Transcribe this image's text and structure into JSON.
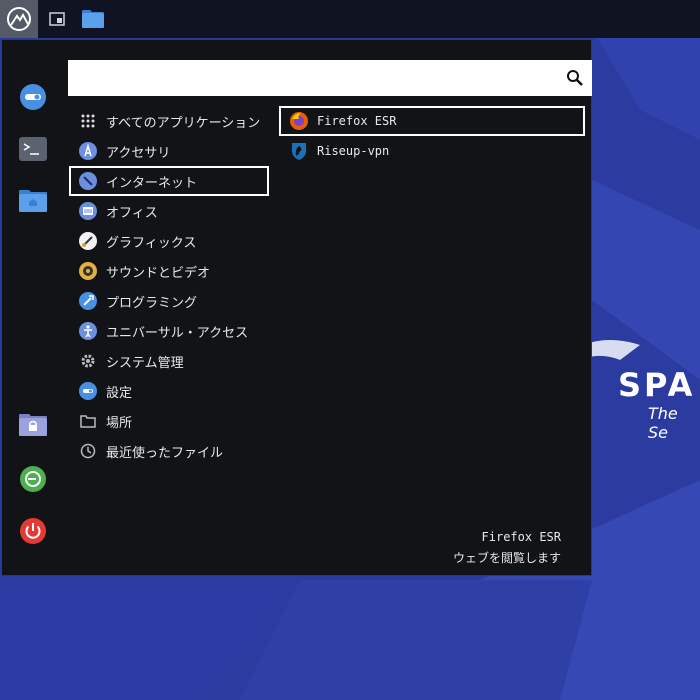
{
  "search": {
    "value": "",
    "placeholder": ""
  },
  "categories": [
    {
      "label": "すべてのアプリケーション",
      "icon": "grid-icon"
    },
    {
      "label": "アクセサリ",
      "icon": "accessories-icon"
    },
    {
      "label": "インターネット",
      "icon": "internet-icon",
      "selected": true
    },
    {
      "label": "オフィス",
      "icon": "office-icon"
    },
    {
      "label": "グラフィックス",
      "icon": "graphics-icon"
    },
    {
      "label": "サウンドとビデオ",
      "icon": "sound-video-icon"
    },
    {
      "label": "プログラミング",
      "icon": "programming-icon"
    },
    {
      "label": "ユニバーサル・アクセス",
      "icon": "accessibility-icon"
    },
    {
      "label": "システム管理",
      "icon": "gear-icon"
    },
    {
      "label": "設定",
      "icon": "settings-icon"
    },
    {
      "label": "場所",
      "icon": "folder-icon"
    },
    {
      "label": "最近使ったファイル",
      "icon": "clock-icon"
    }
  ],
  "apps": [
    {
      "label": "Firefox ESR",
      "icon": "firefox-icon",
      "selected": true
    },
    {
      "label": "Riseup-vpn",
      "icon": "riseup-vpn-icon"
    }
  ],
  "description": {
    "name": "Firefox ESR",
    "text": "ウェブを閲覧します"
  },
  "wallpaper": {
    "brand": "SPA",
    "tagline": "The Se"
  },
  "colors": {
    "accent_blue": "#4a90e2",
    "logout_green": "#4caf50",
    "power_red": "#e53935",
    "wallpaper": "#2a3a9e"
  }
}
